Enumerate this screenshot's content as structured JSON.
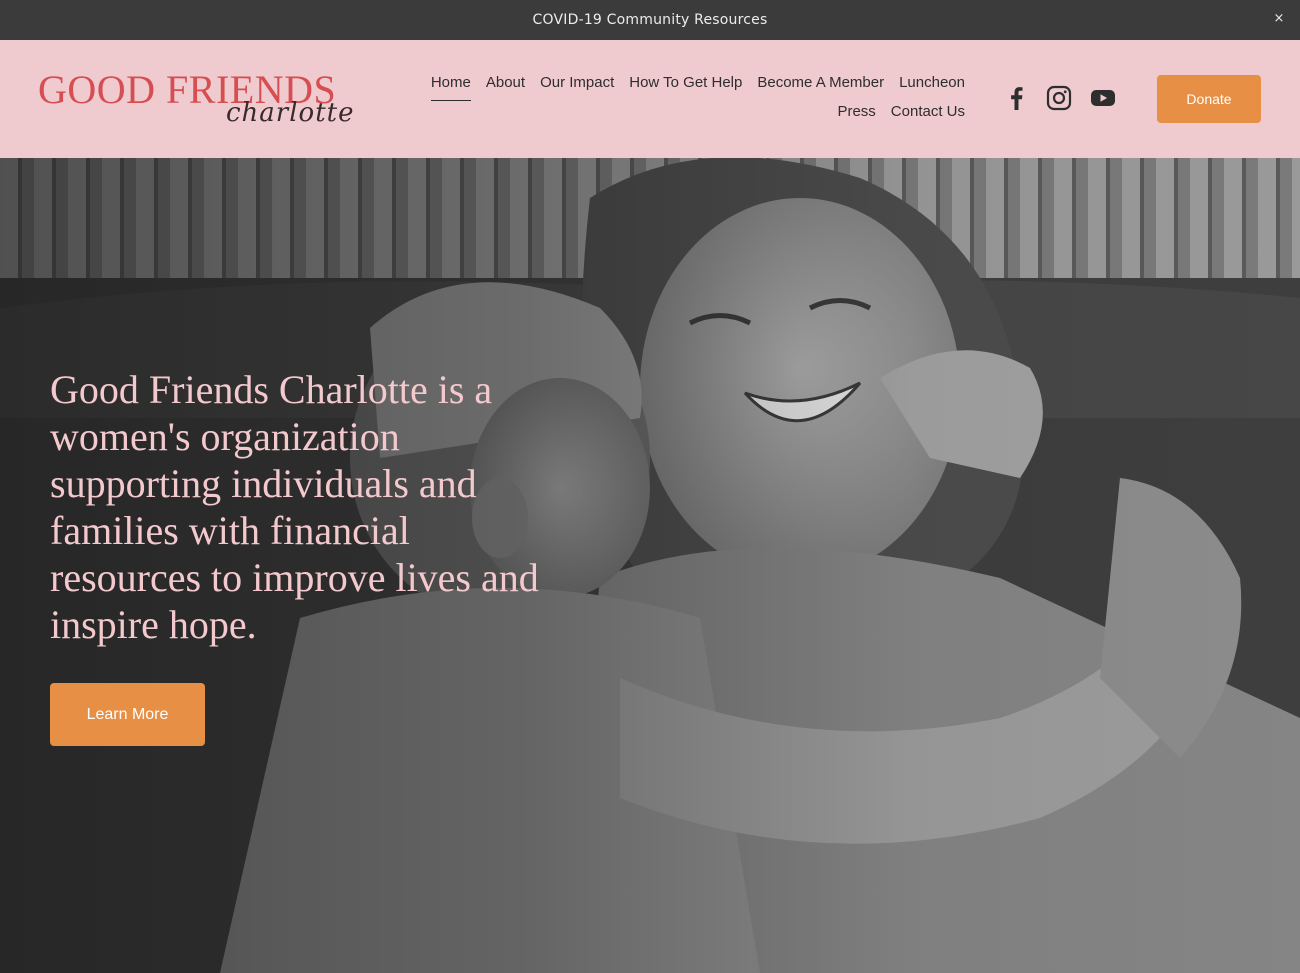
{
  "announcement": {
    "text": "COVID-19 Community Resources",
    "close_glyph": "×"
  },
  "header": {
    "logo": {
      "main": "GOOD FRIENDS",
      "sub": "charlotte"
    },
    "nav_row1": [
      "Home",
      "About",
      "Our Impact",
      "How To Get Help",
      "Become A Member",
      "Luncheon"
    ],
    "nav_row2": [
      "Press",
      "Contact Us"
    ],
    "active_nav": "Home",
    "social_icons": [
      "facebook-icon",
      "instagram-icon",
      "youtube-icon"
    ],
    "donate_label": "Donate"
  },
  "hero": {
    "heading": "Good Friends Charlotte is a women's organization supporting individuals and families with financial resources to improve lives and inspire hope.",
    "button_label": "Learn More"
  },
  "colors": {
    "announcement_bg": "#3b3b3b",
    "header_bg": "#efcacf",
    "logo_red": "#d64e52",
    "accent_orange": "#e78f45",
    "hero_text_pink": "#f3c9cd"
  }
}
